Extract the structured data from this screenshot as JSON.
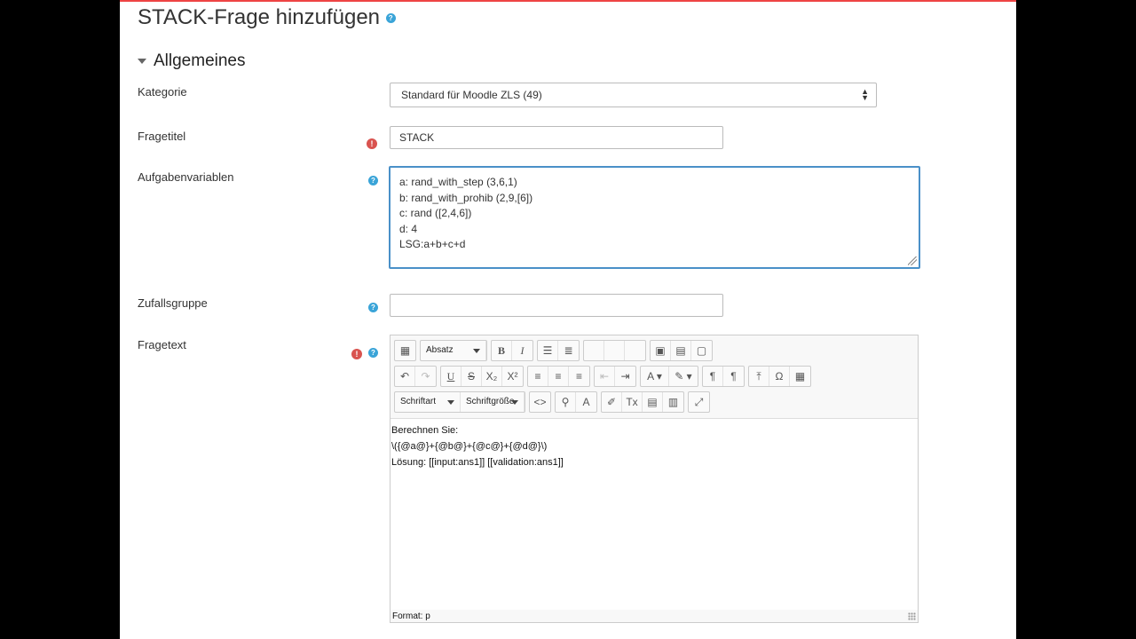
{
  "page_title": "STACK-Frage hinzufügen",
  "section_title": "Allgemeines",
  "fields": {
    "kategorie": {
      "label": "Kategorie",
      "value": "Standard für Moodle ZLS (49)"
    },
    "fragetitel": {
      "label": "Fragetitel",
      "value": "STACK"
    },
    "aufgabenvariablen": {
      "label": "Aufgabenvariablen",
      "lines": [
        "a: rand_with_step (3,6,1)",
        "b: rand_with_prohib (2,9,[6])",
        "c: rand ([2,4,6])",
        "d: 4",
        "LSG:a+b+c+d"
      ]
    },
    "zufallsgruppe": {
      "label": "Zufallsgruppe",
      "value": ""
    },
    "fragetext": {
      "label": "Fragetext",
      "toolbar": {
        "paragraph_format": "Absatz",
        "font": "Schriftart",
        "font_size": "Schriftgröße"
      },
      "content_lines": [
        "Berechnen Sie:",
        "\\({@a@}+{@b@}+{@c@}+{@d@}\\)",
        "Lösung: [[input:ans1]] [[validation:ans1]]"
      ],
      "status": "Format: p"
    }
  },
  "colors": {
    "accent": "#4a90c8",
    "help": "#3aa4d8",
    "error": "#d9534f",
    "top_bar": "#e44"
  }
}
